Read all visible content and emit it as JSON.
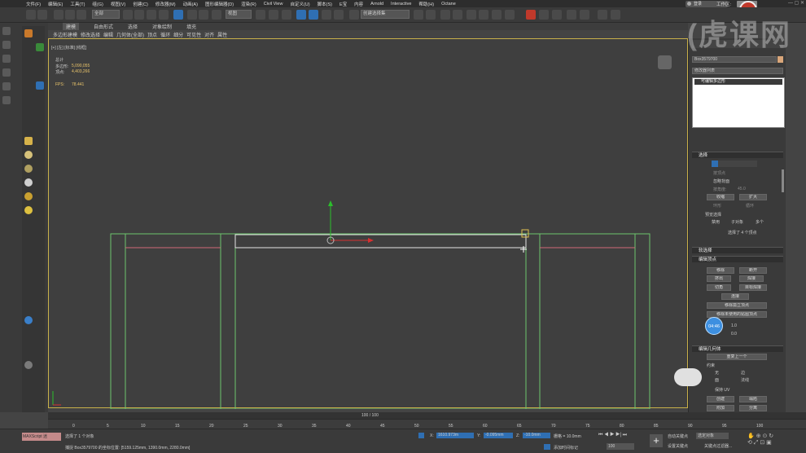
{
  "menu": [
    "文件(F)",
    "编辑(E)",
    "工具(T)",
    "组(G)",
    "视图(V)",
    "创建(C)",
    "修改器(M)",
    "动画(A)",
    "图形编辑器(D)",
    "渲染(R)",
    "Civil View",
    "自定义(U)",
    "脚本(S)",
    "E宝",
    "内容",
    "Arnold",
    "Interactive",
    "帮助(H)",
    "Octane"
  ],
  "login": "登录",
  "workspace": "工作区:",
  "toolbar": {
    "filter": "全部",
    "view": "视图",
    "selection_set": "创建选择集"
  },
  "ribbon": {
    "tabs": [
      "建模",
      "自由形式",
      "选择",
      "对象绘制",
      "填充"
    ],
    "subtabs": [
      "多边形建模",
      "修改选择",
      "编辑",
      "几何体(全部)",
      "顶点",
      "循环",
      "细分",
      "可见性",
      "对齐",
      "属性"
    ]
  },
  "viewport": {
    "label": "[+] [左] [标准] [线框]",
    "stats": {
      "total": "总计",
      "poly_label": "多边形:",
      "poly_value": "5,090,055",
      "vert_label": "顶点:",
      "vert_value": "4,403,266",
      "fps_label": "FPS:",
      "fps_value": "78.441"
    }
  },
  "cmd": {
    "object_name": "Box3579700",
    "modifier_list": "修改器列表",
    "modifier_item": "可编辑多边形",
    "select": {
      "title": "选择",
      "by_vertex": "按顶点",
      "ignore_backface": "忽略背面",
      "by_angle": "按角度:",
      "angle_val": "45.0",
      "shrink": "收缩",
      "grow": "扩大",
      "ring": "环形",
      "loop": "循环",
      "preview": "预览选择",
      "disable": "禁用",
      "subobj": "子对象",
      "multi": "多个",
      "status": "选择了 4 个顶点"
    },
    "soft": {
      "title": "软选择"
    },
    "edit_vertex": {
      "title": "编辑顶点",
      "remove": "移除",
      "break": "断开",
      "extrude": "挤出",
      "weld": "焊接",
      "chamfer": "切角",
      "target_weld": "目标焊接",
      "connect": "连接",
      "remove_isolated": "移除孤立顶点",
      "remove_unused": "移除未使用的贴图顶点",
      "val1": "1.0",
      "val2": "0.0"
    },
    "edit_geo": {
      "title": "编辑几何体",
      "repeat": "重复上一个",
      "constraint": "约束",
      "none": "无",
      "edge": "边",
      "face": "面",
      "normal": "法线",
      "preserve_uv": "保持 UV",
      "create": "创建",
      "collapse": "塌陷",
      "attach": "附加",
      "separate": "分离"
    },
    "scroll_badge": "04:46"
  },
  "timeline": {
    "range": "100 / 100",
    "ticks": [
      "0",
      "5",
      "10",
      "15",
      "20",
      "25",
      "30",
      "35",
      "40",
      "45",
      "50",
      "55",
      "60",
      "65",
      "70",
      "75",
      "80",
      "85",
      "90",
      "95",
      "100"
    ]
  },
  "status": {
    "maxscript": "MAXScript 迷",
    "selected": "选择了 1 个对象",
    "capture": "捕捉 Box3579700 的坐标位置: [5159.125mm, 1390.0mm, 2280.0mm]",
    "x_label": "X:",
    "x_val": "1610.973m",
    "y_label": "Y:",
    "y_val": "-0.095mm",
    "z_label": "Z:",
    "z_val": "-10.0mm",
    "grid": "栅格 = 10.0mm",
    "add_time_tag": "添加时间标记",
    "auto_key": "自动关键点",
    "selected_objects": "选定对象",
    "set_key": "设置关键点",
    "key_filter": "关键点过滤器...",
    "frame": "100"
  },
  "watermark": "(虎课网"
}
